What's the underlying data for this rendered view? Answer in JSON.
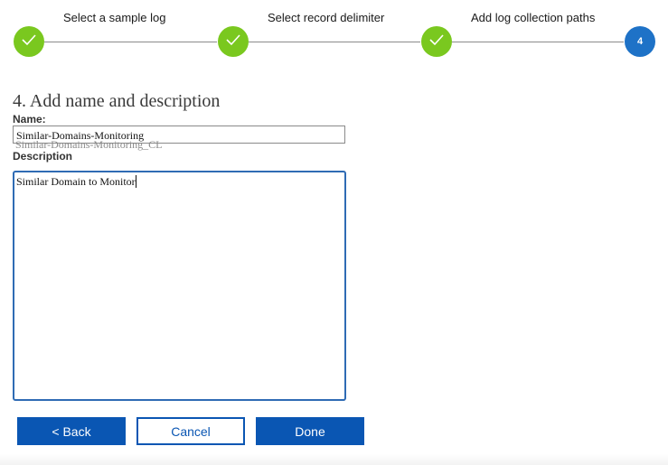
{
  "wizard": {
    "steps": [
      {
        "label": "Select a sample log",
        "status": "complete",
        "icon": "checkmark-icon"
      },
      {
        "label": "Select record delimiter",
        "status": "complete",
        "icon": "checkmark-icon"
      },
      {
        "label": "Add log collection paths",
        "status": "complete",
        "icon": "checkmark-icon"
      },
      {
        "label": "",
        "status": "current",
        "number": "4"
      }
    ],
    "colors": {
      "complete": "#7ac81f",
      "current": "#1e72c7",
      "connector": "#8a8a8a"
    }
  },
  "section": {
    "title": "4. Add name and description"
  },
  "name_field": {
    "label": "Name:",
    "value": "Similar-Domains-Monitoring",
    "autocomplete_hint": "Similar-Domains-Monitoring_CL"
  },
  "description_field": {
    "label": "Description",
    "value": "Similar Domain to Monitor"
  },
  "buttons": {
    "back_label": "< Back",
    "cancel_label": "Cancel",
    "done_label": "Done"
  },
  "colors": {
    "primary_button": "#0a56b3",
    "focus_border": "#2f6bb4"
  }
}
